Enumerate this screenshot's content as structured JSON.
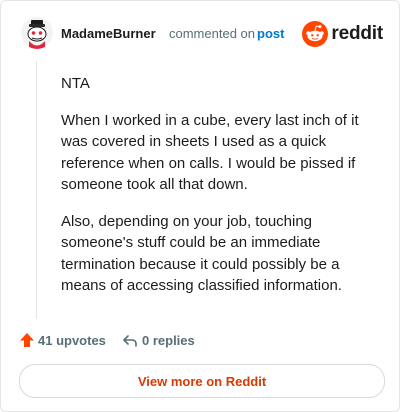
{
  "header": {
    "username": "MadameBurner",
    "commented_text": "commented on",
    "post_link": "post",
    "brand": "reddit",
    "avatar_icon": "snoo-avatar-icon",
    "logo_icon": "reddit-snoo-icon"
  },
  "comment": {
    "paragraphs": [
      "NTA",
      "When I worked in a cube, every last inch of it was covered in sheets I used as a quick reference when on calls. I would be pissed if someone took all that down.",
      "Also, depending on your job, touching someone's stuff could be an immediate termination because it could possibly be a means of accessing classified information."
    ]
  },
  "actions": {
    "upvotes_label": "41 upvotes",
    "replies_label": "0 replies",
    "upvote_icon": "upvote-arrow-icon",
    "reply_icon": "reply-arrow-icon"
  },
  "footer": {
    "view_more_label": "View more on Reddit"
  },
  "colors": {
    "brand_orange": "#ff4500",
    "link_blue": "#0079d3",
    "muted": "#576f76",
    "cta_text": "#d93a00"
  }
}
